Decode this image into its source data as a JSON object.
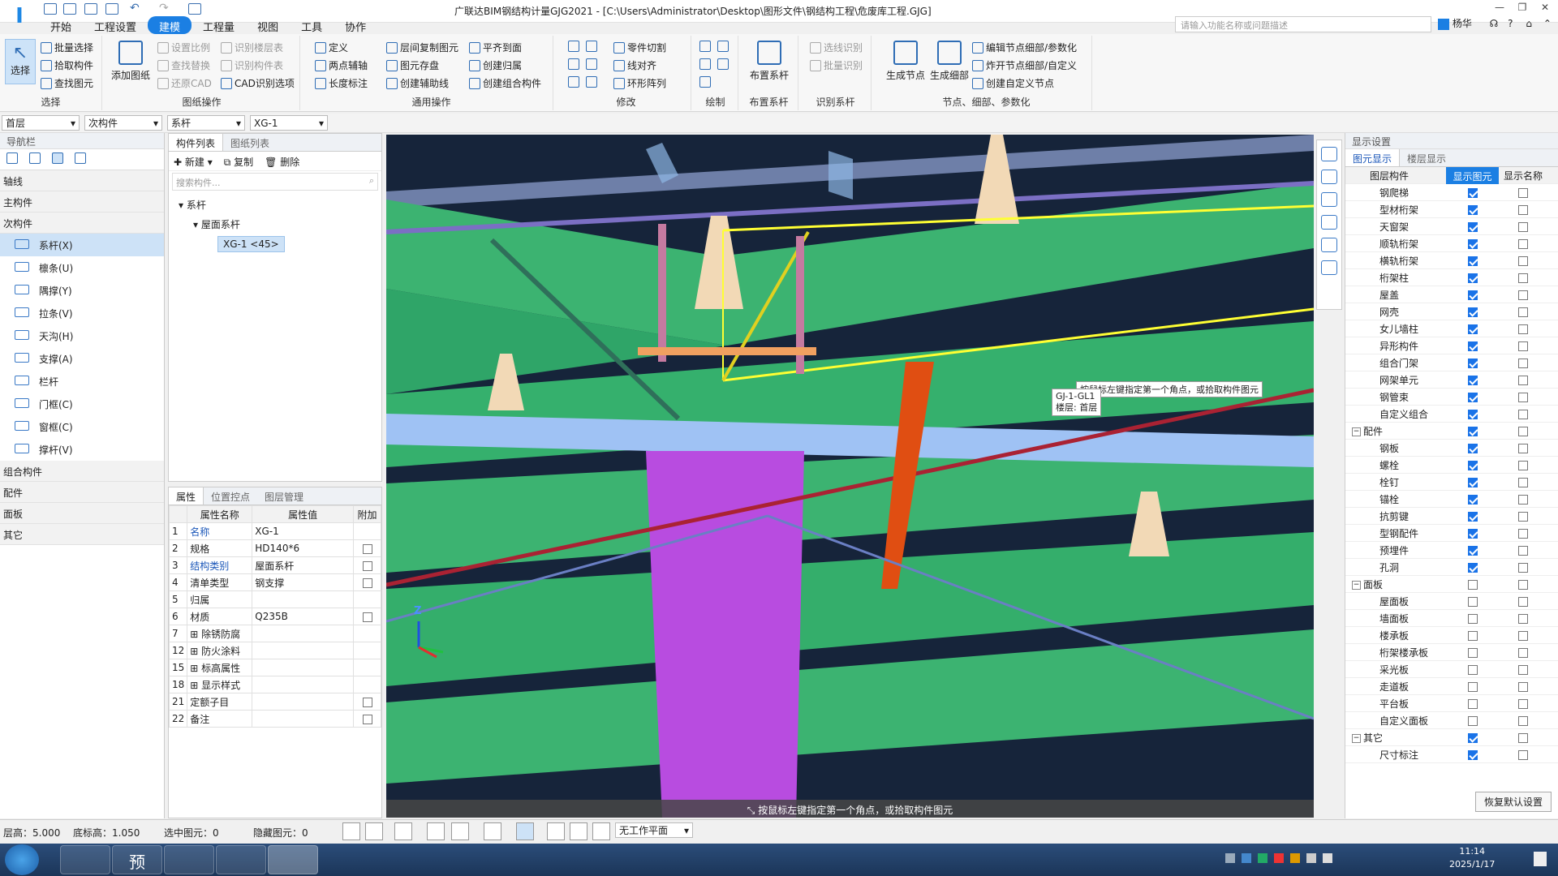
{
  "app": {
    "title": "广联达BIM钢结构计量GJG2021 - [C:\\Users\\Administrator\\Desktop\\图形文件\\钢结构工程\\危废库工程.GJG]",
    "logo": "I",
    "user": "杨华",
    "help": "?"
  },
  "menu": [
    "开始",
    "工程设置",
    "建模",
    "工程量",
    "视图",
    "工具",
    "协作"
  ],
  "search_placeholder": "请输入功能名称或问题描述",
  "ribbon": {
    "select": {
      "label": "选择",
      "big": "选择",
      "items": [
        "批量选择",
        "拾取构件",
        "查找图元"
      ]
    },
    "drawing": {
      "label": "图纸操作",
      "big": "添加图纸",
      "items": [
        "设置比例",
        "查找替换",
        "还原CAD",
        "识别楼层表",
        "识别构件表",
        "CAD识别选项"
      ]
    },
    "general": {
      "label": "通用操作",
      "items": [
        "定义",
        "两点辅轴",
        "长度标注",
        "层间复制图元",
        "图元存盘",
        "创建辅助线",
        "平齐到面",
        "创建归属",
        "创建组合构件"
      ]
    },
    "modify": {
      "label": "修改",
      "items": [
        "零件切割",
        "线对齐",
        "环形阵列"
      ]
    },
    "draw": {
      "label": "绘制"
    },
    "layout": {
      "label": "布置系杆",
      "big": "布置系杆"
    },
    "recognize": {
      "label": "识别系杆",
      "items": [
        "选线识别",
        "批量识别"
      ]
    },
    "nodes": {
      "label": "节点、细部、参数化",
      "big1": "生成节点",
      "big2": "生成细部",
      "items": [
        "编辑节点细部/参数化",
        "炸开节点细部/自定义",
        "创建自定义节点"
      ]
    }
  },
  "selectors": [
    "首层",
    "次构件",
    "系杆",
    "XG-1"
  ],
  "nav": {
    "title": "导航栏",
    "categories_top": [
      "轴线",
      "主构件",
      "次构件"
    ],
    "items": [
      "系杆(X)",
      "檩条(U)",
      "隅撑(Y)",
      "拉条(V)",
      "天沟(H)",
      "支撑(A)",
      "栏杆",
      "门框(C)",
      "窗框(C)",
      "撑杆(V)"
    ],
    "categories_bottom": [
      "组合构件",
      "配件",
      "面板",
      "其它"
    ]
  },
  "complist": {
    "tabs": [
      "构件列表",
      "图纸列表"
    ],
    "toolbar": [
      "新建",
      "复制",
      "删除"
    ],
    "search_placeholder": "搜索构件...",
    "tree": [
      "系杆",
      "屋面系杆",
      "XG-1 <45>"
    ]
  },
  "props": {
    "tabs": [
      "属性",
      "位置控点",
      "图层管理"
    ],
    "headers": [
      "属性名称",
      "属性值",
      "附加"
    ],
    "rows": [
      {
        "n": "1",
        "name": "名称",
        "val": "XG-1",
        "blue": true,
        "chk": null,
        "exp": false
      },
      {
        "n": "2",
        "name": "规格",
        "val": "HD140*6",
        "blue": false,
        "chk": false,
        "exp": false
      },
      {
        "n": "3",
        "name": "结构类别",
        "val": "屋面系杆",
        "blue": true,
        "chk": false,
        "exp": false
      },
      {
        "n": "4",
        "name": "清单类型",
        "val": "钢支撑",
        "blue": false,
        "chk": false,
        "exp": false
      },
      {
        "n": "5",
        "name": "归属",
        "val": "",
        "blue": false,
        "chk": null,
        "exp": false
      },
      {
        "n": "6",
        "name": "材质",
        "val": "Q235B",
        "blue": false,
        "chk": false,
        "exp": false
      },
      {
        "n": "7",
        "name": "除锈防腐",
        "val": "",
        "blue": false,
        "chk": null,
        "exp": true
      },
      {
        "n": "12",
        "name": "防火涂料",
        "val": "",
        "blue": false,
        "chk": null,
        "exp": true
      },
      {
        "n": "15",
        "name": "标高属性",
        "val": "",
        "blue": false,
        "chk": null,
        "exp": true
      },
      {
        "n": "18",
        "name": "显示样式",
        "val": "",
        "blue": false,
        "chk": null,
        "exp": true
      },
      {
        "n": "21",
        "name": "定额子目",
        "val": "",
        "blue": false,
        "chk": false,
        "exp": false
      },
      {
        "n": "22",
        "name": "备注",
        "val": "",
        "blue": false,
        "chk": false,
        "exp": false
      }
    ]
  },
  "viewport": {
    "prompt": "按鼠标左键指定第一个角点，或拾取构件图元",
    "tooltip_line": "按鼠标左键指定第一个角点，或拾取构件图元",
    "tooltip_name": "GJ-1-GL1",
    "tooltip_floor": "楼层: 首层",
    "axis_z": "Z"
  },
  "display": {
    "title": "显示设置",
    "tabs": [
      "图元显示",
      "楼层显示"
    ],
    "headers": [
      "图层构件",
      "显示图元",
      "显示名称"
    ],
    "restore": "恢复默认设置",
    "rows": [
      {
        "name": "钢爬梯",
        "g": false,
        "s": true,
        "n": false
      },
      {
        "name": "型材桁架",
        "g": false,
        "s": true,
        "n": false
      },
      {
        "name": "天窗架",
        "g": false,
        "s": true,
        "n": false
      },
      {
        "name": "顺轨桁架",
        "g": false,
        "s": true,
        "n": false
      },
      {
        "name": "横轨桁架",
        "g": false,
        "s": true,
        "n": false
      },
      {
        "name": "桁架柱",
        "g": false,
        "s": true,
        "n": false
      },
      {
        "name": "屋盖",
        "g": false,
        "s": true,
        "n": false
      },
      {
        "name": "网壳",
        "g": false,
        "s": true,
        "n": false
      },
      {
        "name": "女儿墙柱",
        "g": false,
        "s": true,
        "n": false
      },
      {
        "name": "异形构件",
        "g": false,
        "s": true,
        "n": false
      },
      {
        "name": "组合门架",
        "g": false,
        "s": true,
        "n": false
      },
      {
        "name": "网架单元",
        "g": false,
        "s": true,
        "n": false
      },
      {
        "name": "钢管束",
        "g": false,
        "s": true,
        "n": false
      },
      {
        "name": "自定义组合",
        "g": false,
        "s": true,
        "n": false
      },
      {
        "name": "配件",
        "g": true,
        "s": true,
        "n": false
      },
      {
        "name": "钢板",
        "g": false,
        "s": true,
        "n": false
      },
      {
        "name": "螺栓",
        "g": false,
        "s": true,
        "n": false
      },
      {
        "name": "栓钉",
        "g": false,
        "s": true,
        "n": false
      },
      {
        "name": "锚栓",
        "g": false,
        "s": true,
        "n": false
      },
      {
        "name": "抗剪键",
        "g": false,
        "s": true,
        "n": false
      },
      {
        "name": "型钢配件",
        "g": false,
        "s": true,
        "n": false
      },
      {
        "name": "预埋件",
        "g": false,
        "s": true,
        "n": false
      },
      {
        "name": "孔洞",
        "g": false,
        "s": true,
        "n": false
      },
      {
        "name": "面板",
        "g": true,
        "s": false,
        "n": false
      },
      {
        "name": "屋面板",
        "g": false,
        "s": false,
        "n": false
      },
      {
        "name": "墙面板",
        "g": false,
        "s": false,
        "n": false
      },
      {
        "name": "楼承板",
        "g": false,
        "s": false,
        "n": false
      },
      {
        "name": "桁架楼承板",
        "g": false,
        "s": false,
        "n": false
      },
      {
        "name": "采光板",
        "g": false,
        "s": false,
        "n": false
      },
      {
        "name": "走道板",
        "g": false,
        "s": false,
        "n": false
      },
      {
        "name": "平台板",
        "g": false,
        "s": false,
        "n": false
      },
      {
        "name": "自定义面板",
        "g": false,
        "s": false,
        "n": false
      },
      {
        "name": "其它",
        "g": true,
        "s": true,
        "n": false
      },
      {
        "name": "尺寸标注",
        "g": false,
        "s": true,
        "n": false
      }
    ]
  },
  "status": {
    "floor_height": "层高：5.000",
    "bottom_elev": "底标高：1.050",
    "selected": "选中图元：0",
    "hidden": "隐藏图元：0",
    "workplane": "无工作平面"
  },
  "taskbar": {
    "time": "11:14",
    "date": "2025/1/17",
    "apps": [
      "预"
    ]
  }
}
